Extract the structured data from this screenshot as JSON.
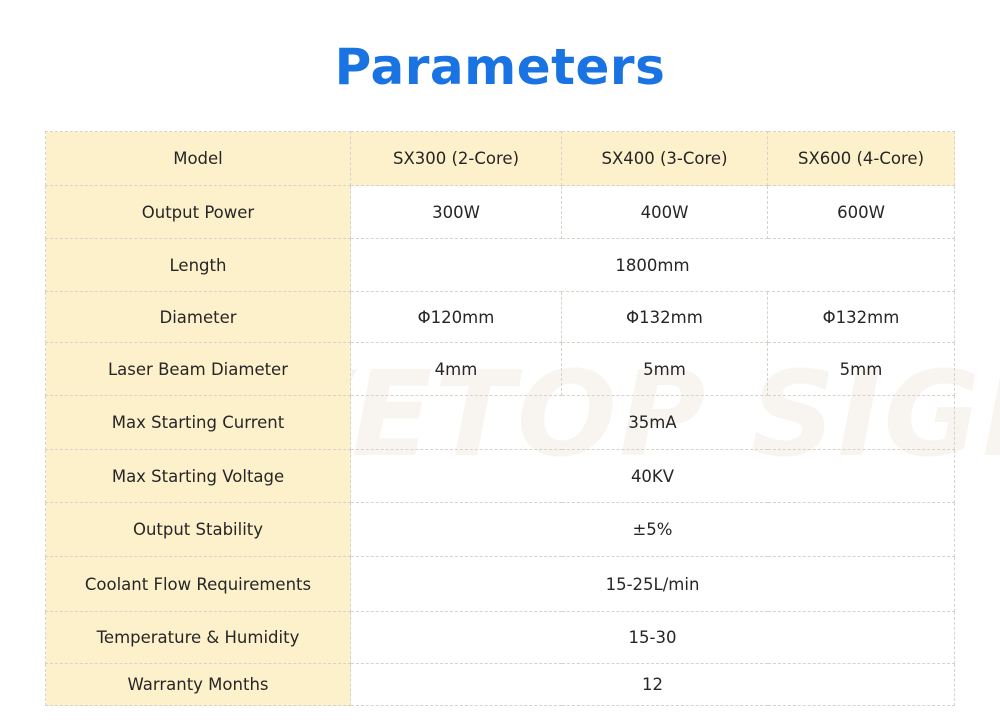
{
  "title": "Parameters",
  "watermark": "WAVETOP SIGN",
  "table": {
    "header": [
      "Model",
      "SX300 (2-Core)",
      "SX400 (3-Core)",
      "SX600 (4-Core)"
    ],
    "rows": [
      {
        "label": "Output Power",
        "values": [
          "300W",
          "400W",
          "600W"
        ]
      },
      {
        "label": "Length",
        "span_value": "1800mm"
      },
      {
        "label": "Diameter",
        "values": [
          "Φ120mm",
          "Φ132mm",
          "Φ132mm"
        ]
      },
      {
        "label": "Laser Beam Diameter",
        "values": [
          "4mm",
          "5mm",
          "5mm"
        ]
      },
      {
        "label": "Max Starting Current",
        "span_value": "35mA"
      },
      {
        "label": "Max Starting Voltage",
        "span_value": "40KV"
      },
      {
        "label": "Output Stability",
        "span_value": "±5%"
      },
      {
        "label": "Coolant Flow Requirements",
        "span_value": "15-25L/min"
      },
      {
        "label": "Temperature & Humidity",
        "span_value": "15-30"
      },
      {
        "label": "Warranty Months",
        "span_value": "12"
      }
    ]
  },
  "colors": {
    "title": "#1a73e2",
    "label_background": "#fdf0c8",
    "border": "#d8d3c8"
  }
}
